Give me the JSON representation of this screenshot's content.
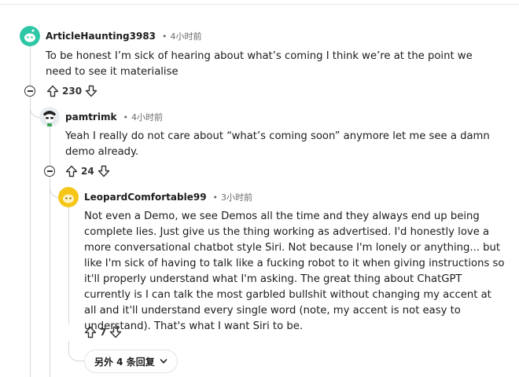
{
  "comments": [
    {
      "username": "ArticleHaunting3983",
      "time": "4小时前",
      "body": "To be honest I’m sick of hearing about what’s coming I think we’re at the point we need to see it materialise",
      "votes": "230",
      "avatar_color": "#2ec7a6"
    },
    {
      "username": "pamtrimk",
      "time": "4小时前",
      "body": "Yeah I really do not care about “what’s coming soon” anymore let me see a damn demo already.",
      "votes": "24"
    },
    {
      "username": "LeopardComfortable99",
      "time": "3小时前",
      "body": "Not even a Demo, we see Demos all the time and they always end up being complete lies. Just give us the thing working as advertised. I'd honestly love a more conversational chatbot style Siri. Not because I'm lonely or anything... but like I'm sick of having to talk like a fucking robot to it when giving instructions so it'll properly understand what I'm asking. The great thing about ChatGPT currently is I can talk the most garbled bullshit without changing my accent at all and it'll understand every single word (note, my accent is not easy to understand). That's what I want Siri to be.",
      "votes": "7",
      "avatar_color": "#f5c518"
    }
  ],
  "separator": "•",
  "more_replies_label": "另外 4 条回复",
  "icons": {
    "upvote": "arrow-up-outline",
    "downvote": "arrow-down-outline",
    "collapse": "circle-minus",
    "expand": "chevron-down"
  }
}
